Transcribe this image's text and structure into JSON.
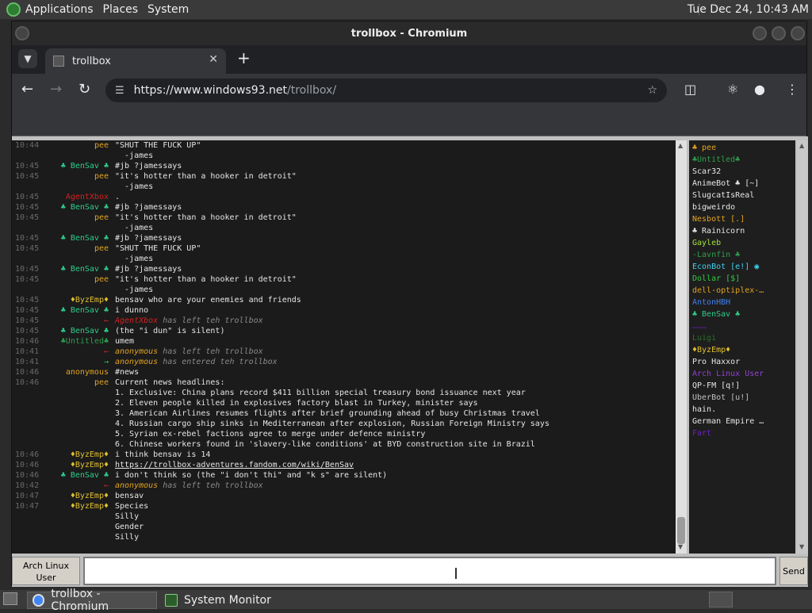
{
  "top_panel": {
    "applications": "Applications",
    "places": "Places",
    "system": "System",
    "clock": "Tue Dec 24, 10:43 AM"
  },
  "window": {
    "title": "trollbox - Chromium"
  },
  "browser": {
    "tab_title": "trollbox",
    "url_host": "https://www.windows93.net",
    "url_path": "/trollbox/"
  },
  "chat": {
    "messages": [
      {
        "time": "10:44",
        "nick": "pee",
        "color": "#e2a320",
        "text": "\"SHUT THE FUCK UP\""
      },
      {
        "time": "",
        "nick": "",
        "color": "#e6e6e6",
        "text": "  -james"
      },
      {
        "time": "10:45",
        "nick": "♣ BenSav ♣",
        "color": "#2ecc8a",
        "text": "#jb ?jamessays"
      },
      {
        "time": "10:45",
        "nick": "pee",
        "color": "#e2a320",
        "text": "\"it's hotter than a hooker in detroit\""
      },
      {
        "time": "",
        "nick": "",
        "color": "#e6e6e6",
        "text": "  -james"
      },
      {
        "time": "10:45",
        "nick": "AgentXbox",
        "color": "#d42020",
        "text": "."
      },
      {
        "time": "10:45",
        "nick": "♣ BenSav ♣",
        "color": "#2ecc8a",
        "text": "#jb ?jamessays"
      },
      {
        "time": "10:45",
        "nick": "pee",
        "color": "#e2a320",
        "text": "\"it's hotter than a hooker in detroit\""
      },
      {
        "time": "",
        "nick": "",
        "color": "#e6e6e6",
        "text": "  -james"
      },
      {
        "time": "10:45",
        "nick": "♣ BenSav ♣",
        "color": "#2ecc8a",
        "text": "#jb ?jamessays"
      },
      {
        "time": "10:45",
        "nick": "pee",
        "color": "#e2a320",
        "text": "\"SHUT THE FUCK UP\""
      },
      {
        "time": "",
        "nick": "",
        "color": "#e6e6e6",
        "text": "  -james"
      },
      {
        "time": "10:45",
        "nick": "♣ BenSav ♣",
        "color": "#2ecc8a",
        "text": "#jb ?jamessays"
      },
      {
        "time": "10:45",
        "nick": "pee",
        "color": "#e2a320",
        "text": "\"it's hotter than a hooker in detroit\""
      },
      {
        "time": "",
        "nick": "",
        "color": "#e6e6e6",
        "text": "  -james"
      },
      {
        "time": "10:45",
        "nick": "♦ByzEmp♦",
        "color": "#e2c030",
        "text": "bensav who are your enemies and friends"
      },
      {
        "time": "10:45",
        "nick": "♣ BenSav ♣",
        "color": "#2ecc8a",
        "text": "i dunno"
      },
      {
        "time": "10:45",
        "nick": "←",
        "color": "#d42020",
        "text": "AgentXbox has left teh trollbox",
        "system": true,
        "sys_nick": "AgentXbox",
        "sys_color": "#d42020"
      },
      {
        "time": "10:45",
        "nick": "♣ BenSav ♣",
        "color": "#2ecc8a",
        "text": "(the \"i dun\" is silent)"
      },
      {
        "time": "10:46",
        "nick": "♣Untitled♣",
        "color": "#2e9e4e",
        "text": "umem"
      },
      {
        "time": "10:41",
        "nick": "←",
        "color": "#d42020",
        "text": "anonymous has left teh trollbox",
        "system": true,
        "sys_nick": "anonymous",
        "sys_color": "#e2a320"
      },
      {
        "time": "10:41",
        "nick": "→",
        "color": "#2ecc40",
        "text": "anonymous has entered teh trollbox",
        "system": true,
        "sys_nick": "anonymous",
        "sys_color": "#e2a320"
      },
      {
        "time": "10:46",
        "nick": "anonymous",
        "color": "#e2a320",
        "text": "#news"
      },
      {
        "time": "10:46",
        "nick": "pee",
        "color": "#e2a320",
        "text": "Current news headlines:"
      },
      {
        "time": "",
        "nick": "",
        "color": "#e6e6e6",
        "text": ""
      },
      {
        "time": "",
        "nick": "",
        "color": "#e6e6e6",
        "text": "1. Exclusive: China plans record $411 billion special treasury bond issuance next year"
      },
      {
        "time": "",
        "nick": "",
        "color": "#e6e6e6",
        "text": "2. Eleven people killed in explosives factory blast in Turkey, minister says"
      },
      {
        "time": "",
        "nick": "",
        "color": "#e6e6e6",
        "text": "3. American Airlines resumes flights after brief grounding ahead of busy Christmas travel"
      },
      {
        "time": "",
        "nick": "",
        "color": "#e6e6e6",
        "text": "4. Russian cargo ship sinks in Mediterranean after explosion, Russian Foreign Ministry says"
      },
      {
        "time": "",
        "nick": "",
        "color": "#e6e6e6",
        "text": "5. Syrian ex-rebel factions agree to merge under defence ministry"
      },
      {
        "time": "",
        "nick": "",
        "color": "#e6e6e6",
        "text": "6. Chinese workers found in 'slavery-like conditions' at BYD construction site in Brazil"
      },
      {
        "time": "10:46",
        "nick": "♦ByzEmp♦",
        "color": "#e2c030",
        "text": "i think bensav is 14"
      },
      {
        "time": "10:46",
        "nick": "♦ByzEmp♦",
        "color": "#e2c030",
        "text": "https://trollbox-adventures.fandom.com/wiki/BenSav",
        "link": true
      },
      {
        "time": "10:46",
        "nick": "♣ BenSav ♣",
        "color": "#2ecc8a",
        "text": "i don't think so (the \"i don't thi\" and \"k s\" are silent)"
      },
      {
        "time": "10:42",
        "nick": "←",
        "color": "#d42020",
        "text": "anonymous has left teh trollbox",
        "system": true,
        "sys_nick": "anonymous",
        "sys_color": "#e2a320"
      },
      {
        "time": "10:47",
        "nick": "♦ByzEmp♦",
        "color": "#e2c030",
        "text": "bensav"
      },
      {
        "time": "10:47",
        "nick": "♦ByzEmp♦",
        "color": "#e2c030",
        "text": "Species"
      },
      {
        "time": "",
        "nick": "",
        "color": "#e6e6e6",
        "text": "Silly"
      },
      {
        "time": "",
        "nick": "",
        "color": "#e6e6e6",
        "text": "Gender"
      },
      {
        "time": "",
        "nick": "",
        "color": "#e6e6e6",
        "text": "Silly"
      }
    ]
  },
  "users": [
    {
      "name": "♣ pee",
      "color": "#e2a320"
    },
    {
      "name": "♣Untitled♣",
      "color": "#2e9e4e"
    },
    {
      "name": "Scar32",
      "color": "#e6e6e6"
    },
    {
      "name": "AnimeBot ♣ [~]",
      "color": "#e6e6e6"
    },
    {
      "name": "SlugcatIsReal",
      "color": "#e6e6e6"
    },
    {
      "name": "bigweirdo",
      "color": "#e6e6e6"
    },
    {
      "name": "Nesbott [.]",
      "color": "#e2a320"
    },
    {
      "name": "♣ Rainicorn",
      "color": "#e6e6e6"
    },
    {
      "name": "Gayleb",
      "color": "#a0e040"
    },
    {
      "name": "-Lavnfin ♣",
      "color": "#2e9e4e"
    },
    {
      "name": "EconBot [e!] ◉",
      "color": "#40d0f0"
    },
    {
      "name": "Dollar [$]",
      "color": "#2ecc40"
    },
    {
      "name": "dell-optiplex-…",
      "color": "#e2a320"
    },
    {
      "name": "AntonHBH",
      "color": "#4080f0"
    },
    {
      "name": "♣ BenSav ♣",
      "color": "#2ecc8a"
    },
    {
      "name": "………",
      "color": "#6020a0"
    },
    {
      "name": "Luigi",
      "color": "#2e6e2e"
    },
    {
      "name": "♦ByzEmp♦",
      "color": "#e2c030"
    },
    {
      "name": "Pro Haxxor",
      "color": "#e6e6e6"
    },
    {
      "name": "Arch Linux User",
      "color": "#9040d0"
    },
    {
      "name": "QP-FM [q!]",
      "color": "#e6e6e6"
    },
    {
      "name": "UberBot [u!]",
      "color": "#c0c0c0"
    },
    {
      "name": "hain.",
      "color": "#e6e6e6"
    },
    {
      "name": "German Empire …",
      "color": "#e6e6e6"
    },
    {
      "name": "Fart",
      "color": "#7020c0"
    }
  ],
  "input": {
    "nick_label": "Arch Linux User",
    "send_label": "Send",
    "value": ""
  },
  "taskbar": {
    "chromium_label": "trollbox - Chromium",
    "sysmon_label": "System Monitor"
  }
}
